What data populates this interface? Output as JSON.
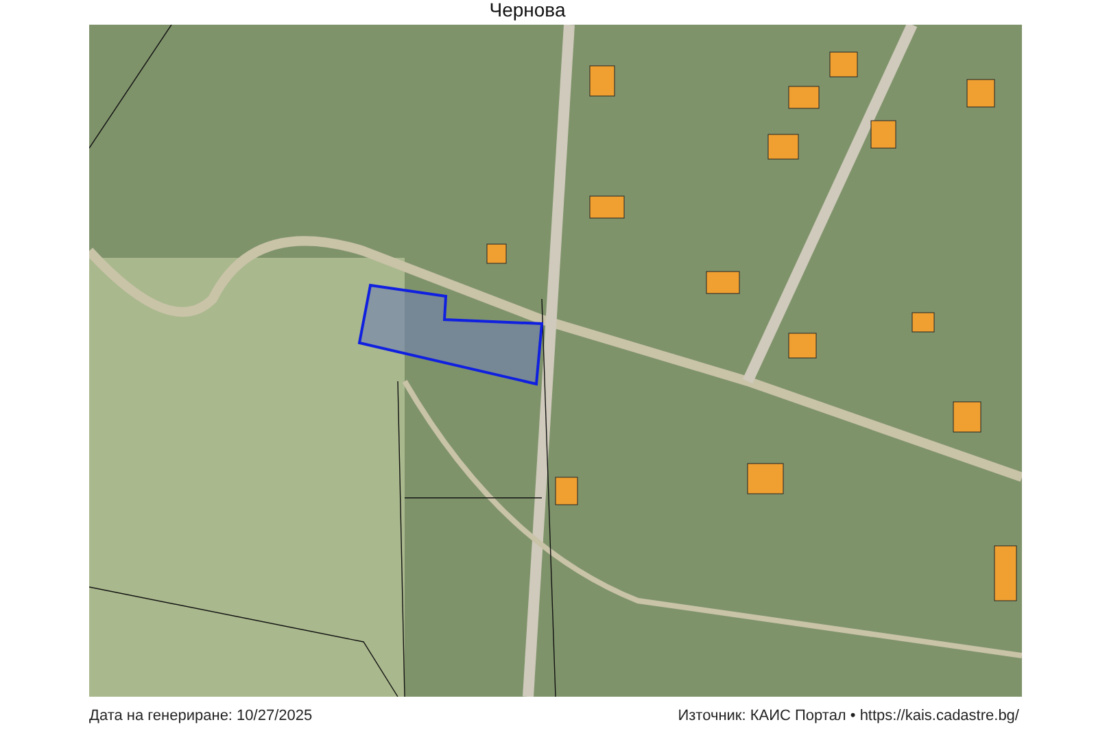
{
  "title": "Чернова",
  "footer": {
    "generated": "Дата на генериране: 10/27/2025",
    "source": "Източник: КАИС Портал • https://kais.cadastre.bg/"
  }
}
